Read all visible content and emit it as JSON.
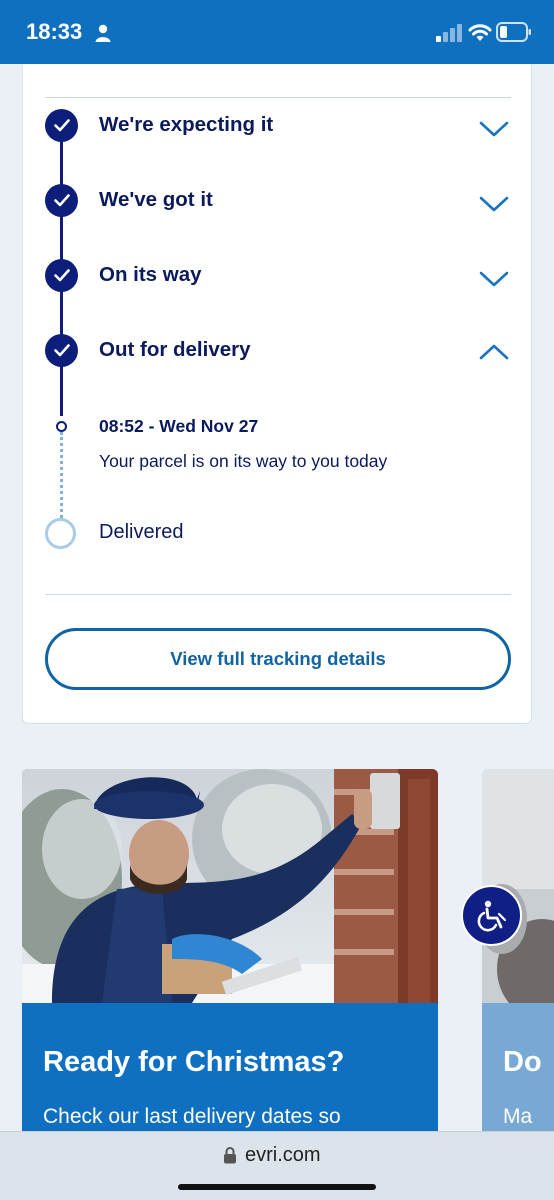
{
  "status_bar": {
    "time": "18:33",
    "icons": [
      "person-icon",
      "signal-icon",
      "wifi-icon",
      "battery-icon"
    ]
  },
  "tracking": {
    "steps": [
      {
        "label": "We're expecting it",
        "state": "complete",
        "expanded": false
      },
      {
        "label": "We've got it",
        "state": "complete",
        "expanded": false
      },
      {
        "label": "On its way",
        "state": "complete",
        "expanded": false
      },
      {
        "label": "Out for delivery",
        "state": "complete",
        "expanded": true
      },
      {
        "label": "Delivered",
        "state": "pending"
      }
    ],
    "event": {
      "time": "08:52 - Wed Nov 27",
      "description": "Your parcel is on its way to you today"
    },
    "full_details_button": "View full tracking details"
  },
  "promos": [
    {
      "title": "Ready for Christmas?",
      "text": "Check our last delivery dates so"
    },
    {
      "title": "Do",
      "text": "Ma"
    }
  ],
  "accessibility_button": {
    "icon": "wheelchair-icon"
  },
  "browser": {
    "url": "evri.com",
    "icon": "lock-icon"
  },
  "colors": {
    "brand_blue": "#1070c0",
    "navy": "#0c1e7a",
    "promo_blue": "#0f70c2",
    "pending_light_blue": "#a8cbe8"
  }
}
